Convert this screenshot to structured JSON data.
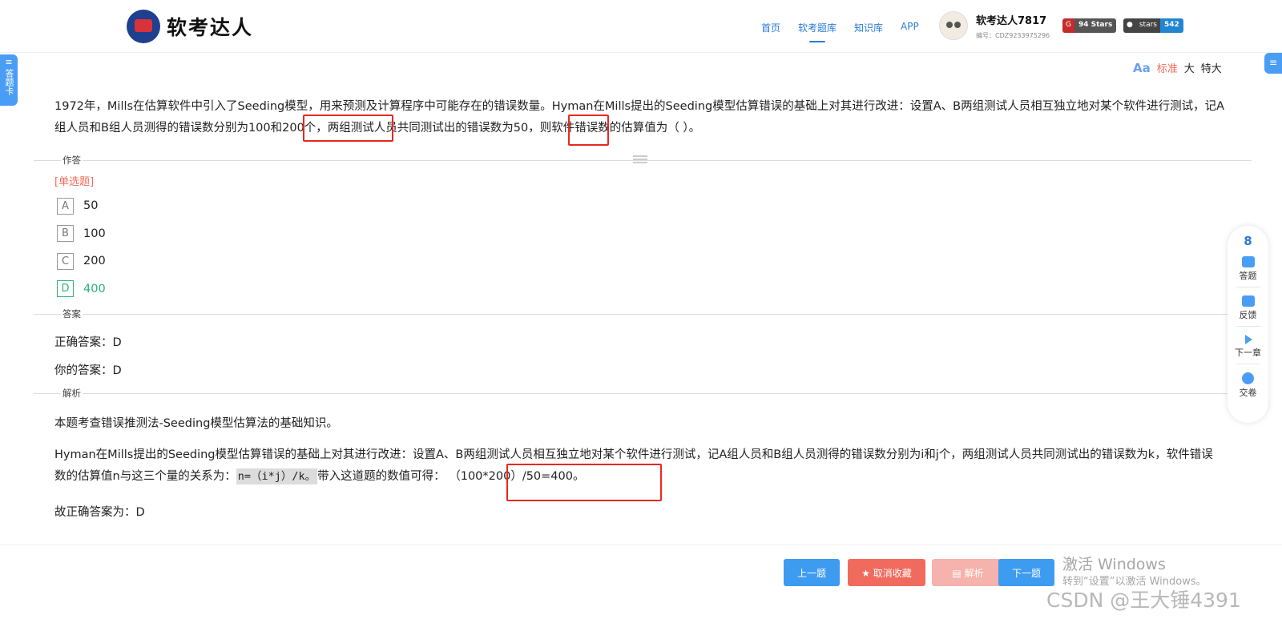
{
  "header": {
    "logo_text": "软考达人",
    "nav": [
      {
        "label": "首页",
        "active": false
      },
      {
        "label": "软考题库",
        "active": true
      },
      {
        "label": "知识库",
        "active": false
      },
      {
        "label": "APP",
        "active": false
      }
    ],
    "user": {
      "name": "软考达人7817",
      "id": "编号：CDZ9233975296"
    },
    "badges": [
      {
        "left": "94 Stars",
        "icon": "gitee-icon"
      },
      {
        "left": "stars",
        "right": "542",
        "icon": "github-icon"
      }
    ]
  },
  "side": {
    "left_tab": "答题卡",
    "right_tab": "≡"
  },
  "fontsize": {
    "icon": "Aa",
    "standard": "标准",
    "big": "大",
    "xl": "特大"
  },
  "question": {
    "text_a": "1972年，Mills在估算软件中引入了Seeding模型，用来预测及计算程序中可能存在的错误数量。Hyman在Mills提出的Seeding模型估算错误的基础上对其进行改进：设置A、B两组测试人员相互独立地对某个软件进行测试，记A组人员和B组人员测得的错误数分别为100和200个，两组测试人员共同测试出的错误数为50，则软件错误数的估算值为（  ）。"
  },
  "sections": {
    "answer_area": "作答",
    "answer": "答案",
    "analysis": "解析"
  },
  "qtype": "[单选题]",
  "options": [
    {
      "letter": "A",
      "text": "50"
    },
    {
      "letter": "B",
      "text": "100"
    },
    {
      "letter": "C",
      "text": "200"
    },
    {
      "letter": "D",
      "text": "400"
    }
  ],
  "answers": {
    "correct": "正确答案：D",
    "yours": "你的答案：D"
  },
  "analysis": {
    "p1": "本题考查错误推测法-Seeding模型估算法的基础知识。",
    "p2_a": "Hyman在Mills提出的Seeding模型估算错误的基础上对其进行改进：设置A、B两组测试人员相互独立地对某个软件进行测试，记A组人员和B组人员测得的错误数分别为i和j个，两组测试人员共同测试出的错误数为k，软件错误数的估算值n与这三个量的关系为：",
    "p2_code": "n=（i*j）/k。",
    "p2_b": "带入这道题的数值可得：",
    "p2_c": "（100*200）/50=400。",
    "p3": "故正确答案为：D"
  },
  "float_panel": {
    "count": "8",
    "items": [
      {
        "label": "答题",
        "icon": "answer-icon"
      },
      {
        "label": "反馈",
        "icon": "feedback-icon"
      },
      {
        "label": "下一章",
        "icon": "next-chapter-icon"
      },
      {
        "label": "交卷",
        "icon": "submit-icon"
      }
    ]
  },
  "buttons": {
    "prev": "上一题",
    "fav": "★ 取消收藏",
    "explain": "▤ 解析",
    "next": "下一题"
  },
  "watermarks": {
    "win1": "激活 Windows",
    "win2": "转到“设置”以激活 Windows。",
    "csdn": "CSDN @王大锤4391"
  }
}
